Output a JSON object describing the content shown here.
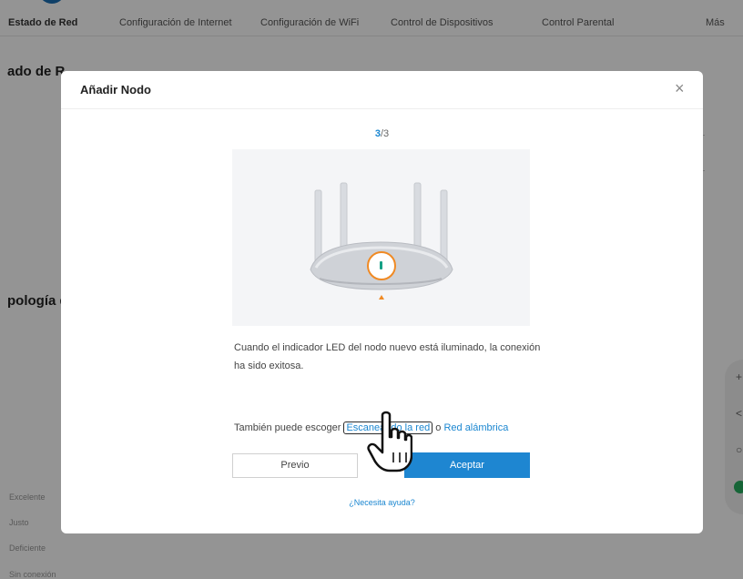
{
  "nav": {
    "items": [
      {
        "label": "Estado de Red",
        "active": true
      },
      {
        "label": "Configuración de Internet"
      },
      {
        "label": "Configuración de WiFi"
      },
      {
        "label": "Control de Dispositivos"
      },
      {
        "label": "Control Parental"
      },
      {
        "label": "Más"
      }
    ]
  },
  "background": {
    "heading1": "ado de R",
    "heading2": "pología d",
    "legend": [
      "Excelente",
      "Justo",
      "Deficiente",
      "Sin conexión"
    ],
    "tools": [
      "+",
      "<",
      "○"
    ]
  },
  "modal": {
    "title": "Añadir Nodo",
    "close": "×",
    "step_current": "3",
    "step_total": "/3",
    "description": "Cuando el indicador LED del nodo nuevo está iluminado, la conexión ha sido exitosa.",
    "alt_prefix": "También puede escoger ",
    "alt_link1": "Escaneando la red",
    "alt_or": "o ",
    "alt_link2": "Red alámbrica",
    "prev_label": "Previo",
    "accept_label": "Aceptar",
    "help_label": "¿Necesita ayuda?"
  },
  "colors": {
    "accent": "#1e86d1",
    "led_ring": "#f08a24",
    "led": "#16a085"
  },
  "icons": {
    "cursor": "hand-pointer-icon",
    "close": "close-icon"
  }
}
